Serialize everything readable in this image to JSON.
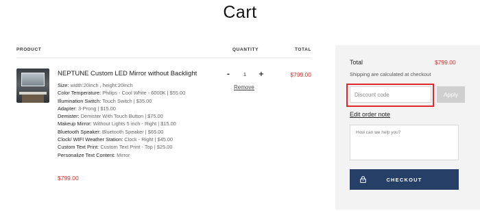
{
  "page": {
    "title": "Cart"
  },
  "cart": {
    "headers": {
      "product": "PRODUCT",
      "quantity": "QUANTITY",
      "total": "TOTAL"
    },
    "item": {
      "image_icon": "led-mirror-thumbnail",
      "name": "NEPTUNE Custom LED Mirror without Backlight",
      "attributes": [
        {
          "label": "Size:",
          "value": "width:20inch , height:20inch"
        },
        {
          "label": "Color Temperature:",
          "value": "Philips - Cool White - 6000K | $55.00"
        },
        {
          "label": "Illumination Switch:",
          "value": "Touch Switch | $35.00"
        },
        {
          "label": "Adapter:",
          "value": "3-Prong | $15.00"
        },
        {
          "label": "Demister:",
          "value": "Demister With Touch Button | $75.00"
        },
        {
          "label": "Makeup Mirror:",
          "value": "Without Lights 5 inch - Right | $15.00"
        },
        {
          "label": "Bluetooth Speaker:",
          "value": "Bluetooth Speaker | $65.00"
        },
        {
          "label": "Clock/ WIFI Weather Station:",
          "value": "Clock - Right | $45.00"
        },
        {
          "label": "Custom Text Print:",
          "value": "Custom Text Print - Top | $25.00"
        },
        {
          "label": "Personalize Text Content:",
          "value": "Mirror"
        }
      ],
      "price": "$799.00",
      "quantity": {
        "minus_label": "-",
        "value": "1",
        "plus_label": "+"
      },
      "remove_label": "Remove",
      "line_total": "$799.00"
    }
  },
  "summary": {
    "total_label": "Total",
    "total_value": "$799.00",
    "shipping_note": "Shipping are calculated at checkout",
    "discount": {
      "placeholder": "Discount code",
      "value": ""
    },
    "apply_label": "Apply",
    "edit_note_label": "Edit order note",
    "order_note": {
      "placeholder": "How can we help you?",
      "value": ""
    },
    "checkout_label": "CHECKOUT",
    "checkout_icon": "lock-icon"
  },
  "colors": {
    "accent_price": "#d0312d",
    "checkout_bg": "#253f66",
    "highlight_border": "#e0272f",
    "summary_bg": "#f3f3f3"
  }
}
